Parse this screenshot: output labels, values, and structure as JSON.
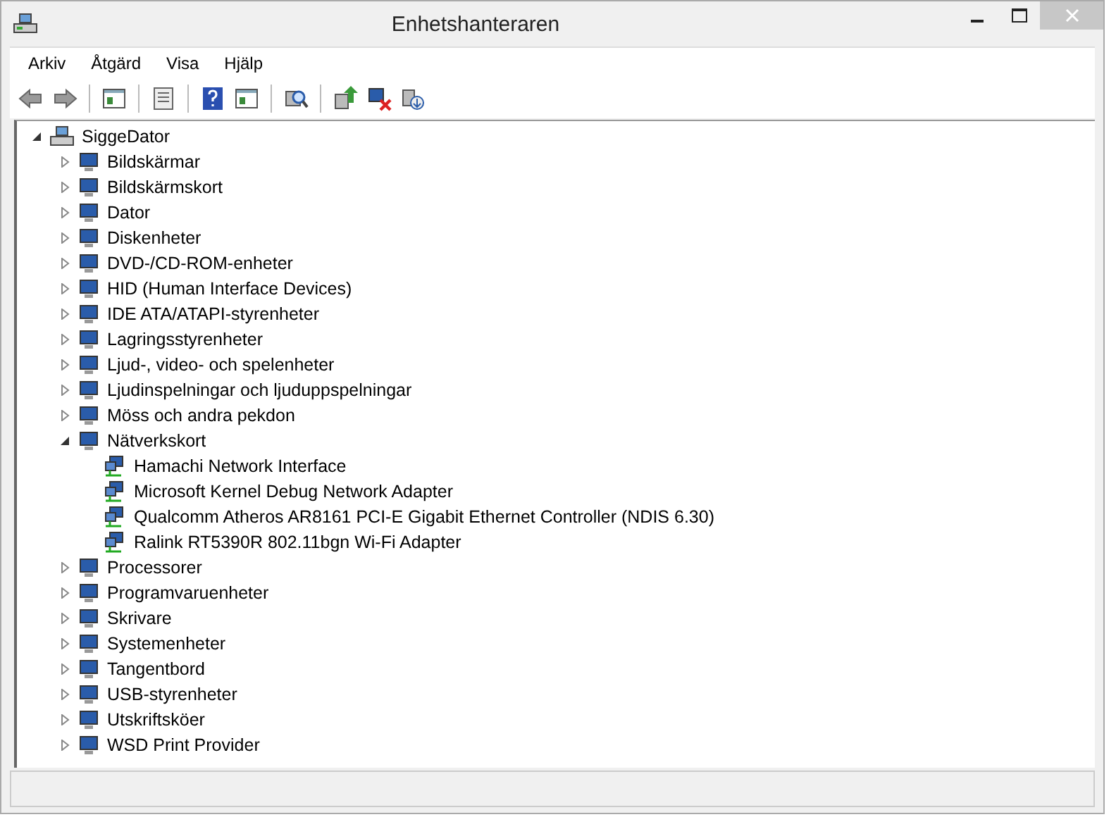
{
  "window": {
    "title": "Enhetshanteraren"
  },
  "menu": [
    "Arkiv",
    "Åtgärd",
    "Visa",
    "Hjälp"
  ],
  "tree": {
    "label": "SiggeDator",
    "expanded": true,
    "children": [
      {
        "label": "Bildskärmar",
        "expanded": false
      },
      {
        "label": "Bildskärmskort",
        "expanded": false
      },
      {
        "label": "Dator",
        "expanded": false
      },
      {
        "label": "Diskenheter",
        "expanded": false
      },
      {
        "label": "DVD-/CD-ROM-enheter",
        "expanded": false
      },
      {
        "label": "HID (Human Interface Devices)",
        "expanded": false
      },
      {
        "label": "IDE ATA/ATAPI-styrenheter",
        "expanded": false
      },
      {
        "label": "Lagringsstyrenheter",
        "expanded": false
      },
      {
        "label": "Ljud-, video- och spelenheter",
        "expanded": false
      },
      {
        "label": "Ljudinspelningar och ljuduppspelningar",
        "expanded": false
      },
      {
        "label": "Möss och andra pekdon",
        "expanded": false
      },
      {
        "label": "Nätverkskort",
        "expanded": true,
        "children": [
          {
            "label": "Hamachi Network Interface"
          },
          {
            "label": "Microsoft Kernel Debug Network Adapter"
          },
          {
            "label": "Qualcomm Atheros AR8161 PCI-E Gigabit Ethernet Controller (NDIS 6.30)"
          },
          {
            "label": "Ralink RT5390R 802.11bgn Wi-Fi Adapter"
          }
        ]
      },
      {
        "label": "Processorer",
        "expanded": false
      },
      {
        "label": "Programvaruenheter",
        "expanded": false
      },
      {
        "label": "Skrivare",
        "expanded": false
      },
      {
        "label": "Systemenheter",
        "expanded": false
      },
      {
        "label": "Tangentbord",
        "expanded": false
      },
      {
        "label": "USB-styrenheter",
        "expanded": false
      },
      {
        "label": "Utskriftsköer",
        "expanded": false
      },
      {
        "label": "WSD Print Provider",
        "expanded": false
      }
    ]
  }
}
